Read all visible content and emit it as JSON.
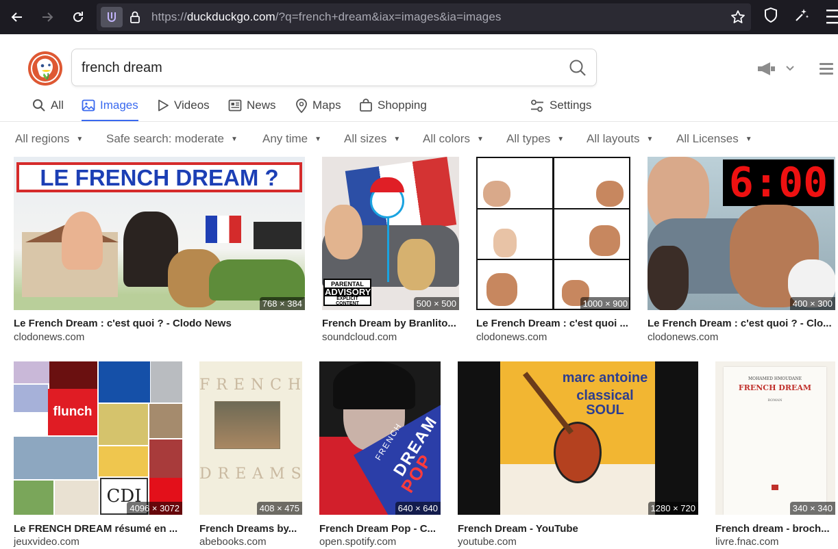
{
  "browser": {
    "url_scheme": "https://",
    "url_host": "duckduckgo.com",
    "url_path": "/?q=french+dream&iax=images&ia=images"
  },
  "search": {
    "query": "french dream"
  },
  "tabs": [
    {
      "label": "All"
    },
    {
      "label": "Images"
    },
    {
      "label": "Videos"
    },
    {
      "label": "News"
    },
    {
      "label": "Maps"
    },
    {
      "label": "Shopping"
    },
    {
      "label": "Settings"
    }
  ],
  "filters": [
    {
      "label": "All regions"
    },
    {
      "label": "Safe search: moderate"
    },
    {
      "label": "Any time"
    },
    {
      "label": "All sizes"
    },
    {
      "label": "All colors"
    },
    {
      "label": "All types"
    },
    {
      "label": "All layouts"
    },
    {
      "label": "All Licenses"
    }
  ],
  "thumb_overlays": {
    "r1_headline": "LE FRENCH DREAM ?",
    "r2_advisory_1": "PARENTAL",
    "r2_advisory_2": "ADVISORY",
    "r2_advisory_3": "EXPLICIT CONTENT",
    "r4_clock": "6:00",
    "r5_brand": "flunch",
    "r5_cdi": "CDI",
    "r6_word1": "FRENCH",
    "r6_word2": "DREAMS",
    "r7_text1": "FRENCH",
    "r7_text2": "DREAM",
    "r7_text3": "POP",
    "r8_artist": "marc antoine",
    "r8_album": "classical SOUL",
    "r9_author": "MOHAMED HMOUDANE",
    "r9_title": "FRENCH DREAM",
    "r9_genre": "ROMAN"
  },
  "results": [
    {
      "title": "Le French Dream : c'est quoi ? - Clodo News",
      "domain": "clodonews.com",
      "dimensions": "768 × 384"
    },
    {
      "title": "French Dream by Branlito...",
      "domain": "soundcloud.com",
      "dimensions": "500 × 500"
    },
    {
      "title": "Le French Dream : c'est quoi ...",
      "domain": "clodonews.com",
      "dimensions": "1000 × 900"
    },
    {
      "title": "Le French Dream : c'est quoi ? - Clo...",
      "domain": "clodonews.com",
      "dimensions": "400 × 300"
    },
    {
      "title": "Le FRENCH DREAM résumé en ...",
      "domain": "jeuxvideo.com",
      "dimensions": "4096 × 3072"
    },
    {
      "title": "French Dreams by...",
      "domain": "abebooks.com",
      "dimensions": "408 × 475"
    },
    {
      "title": "French Dream Pop - C...",
      "domain": "open.spotify.com",
      "dimensions": "640 × 640"
    },
    {
      "title": "French Dream - YouTube",
      "domain": "youtube.com",
      "dimensions": "1280 × 720"
    },
    {
      "title": "French dream - broch...",
      "domain": "livre.fnac.com",
      "dimensions": "340 × 340"
    }
  ]
}
